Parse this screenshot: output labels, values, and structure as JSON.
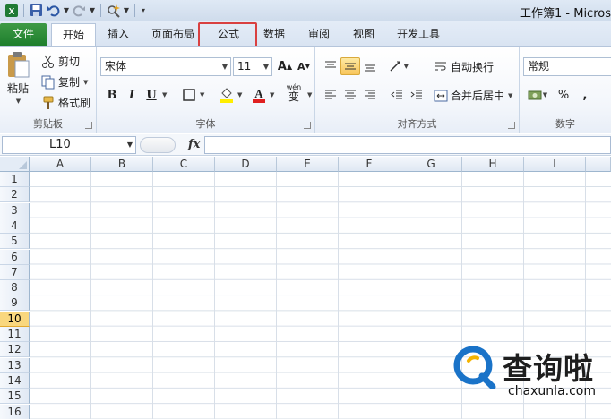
{
  "window": {
    "title": "工作簿1 - Micros"
  },
  "tabs": [
    {
      "label": "文件",
      "kind": "file"
    },
    {
      "label": "开始",
      "kind": "active"
    },
    {
      "label": "插入",
      "kind": "normal"
    },
    {
      "label": "页面布局",
      "kind": "normal"
    },
    {
      "label": "公式",
      "kind": "highlighted"
    },
    {
      "label": "数据",
      "kind": "normal"
    },
    {
      "label": "审阅",
      "kind": "normal"
    },
    {
      "label": "视图",
      "kind": "normal"
    },
    {
      "label": "开发工具",
      "kind": "normal"
    }
  ],
  "clipboard": {
    "paste_label": "粘贴",
    "cut_label": "剪切",
    "copy_label": "复制",
    "format_painter_label": "格式刷",
    "group_label": "剪贴板"
  },
  "font": {
    "font_name": "宋体",
    "font_size": "11",
    "bold": "B",
    "italic": "I",
    "underline": "U",
    "grow": "A",
    "shrink": "A",
    "phonetic": "wén",
    "group_label": "字体"
  },
  "alignment": {
    "wrap_text_label": "自动换行",
    "merge_center_label": "合并后居中",
    "group_label": "对齐方式"
  },
  "number": {
    "format_value": "常规",
    "percent": "%",
    "comma": ",",
    "group_label": "数字"
  },
  "formula_bar": {
    "name_box_value": "L10",
    "fx_label": "fx",
    "formula_value": ""
  },
  "sheet": {
    "columns": [
      "A",
      "B",
      "C",
      "D",
      "E",
      "F",
      "G",
      "H",
      "I"
    ],
    "rows": [
      "1",
      "2",
      "3",
      "4",
      "5",
      "6",
      "7",
      "8",
      "9",
      "10",
      "11",
      "12",
      "13",
      "14",
      "15",
      "16"
    ],
    "selected_row": "10"
  },
  "watermark": {
    "brand_cn": "查询啦",
    "brand_url": "chaxunla.com"
  },
  "colors": {
    "file_tab": "#2a8a35",
    "highlight_box": "#d94040",
    "selected_row": "#f9d77e",
    "accent": "#1a73c8"
  }
}
